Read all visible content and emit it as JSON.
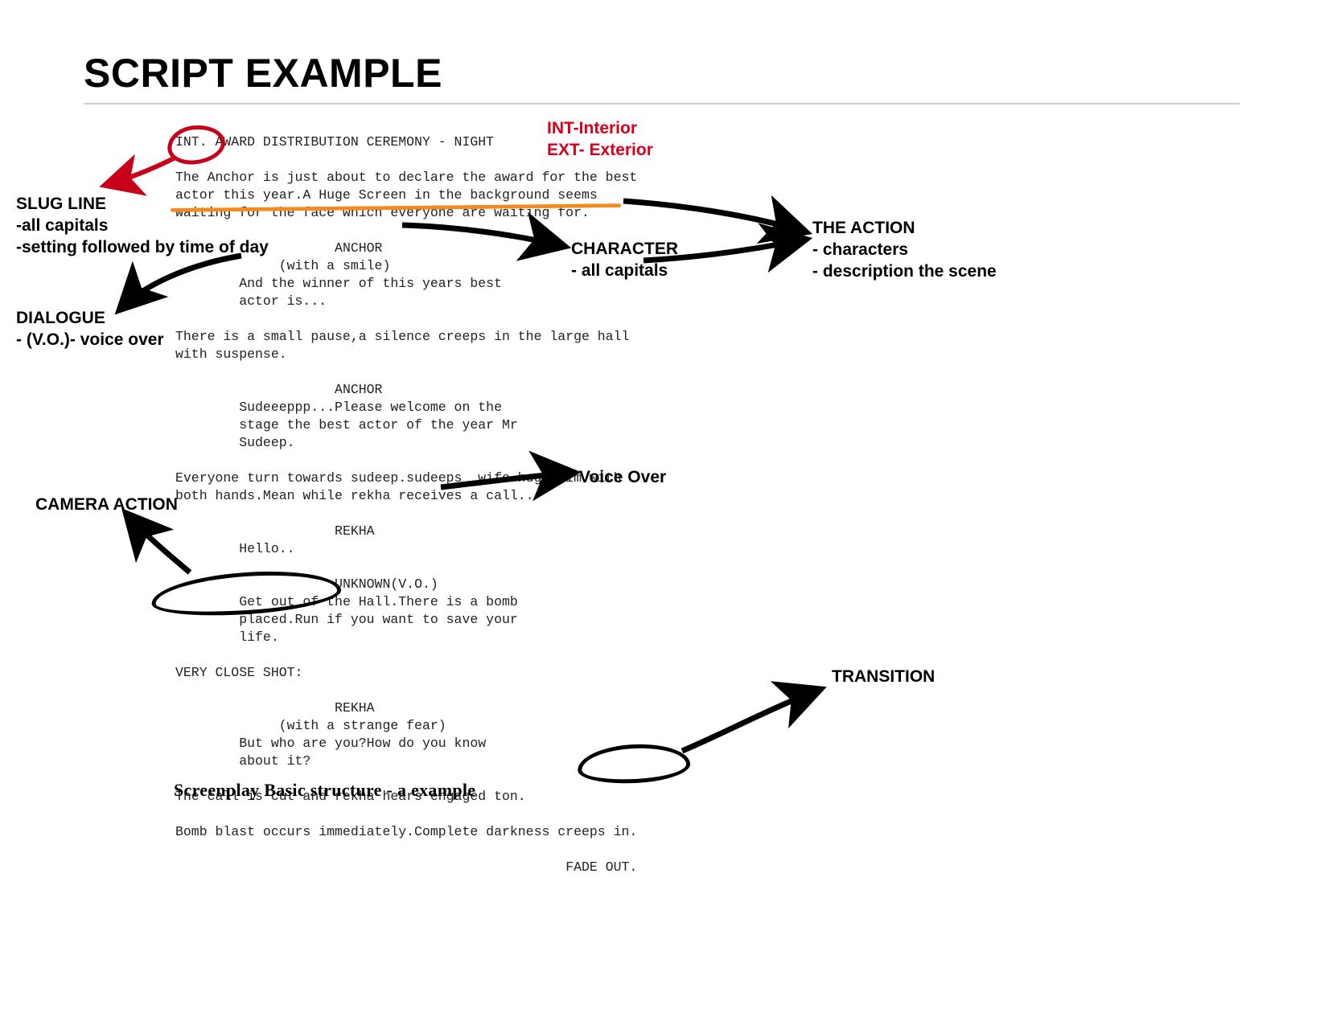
{
  "title": "SCRIPT EXAMPLE",
  "int_ext_note": "INT-Interior\nEXT- Exterior",
  "annotations": {
    "slug_line": "SLUG LINE\n-all capitals\n-setting followed by time of day",
    "dialogue": "DIALOGUE\n- (V.O.)- voice over",
    "camera": "CAMERA ACTION",
    "character": "CHARACTER\n- all capitals",
    "voice_over": "Voice Over",
    "action": "THE ACTION\n- characters\n- description the scene",
    "transition": "TRANSITION"
  },
  "screenplay_text": "INT. AWARD DISTRIBUTION CEREMONY - NIGHT\n\nThe Anchor is just about to declare the award for the best\nactor this year.A Huge Screen in the background seems\nwaiting for the face which everyone are waiting for.\n\n                    ANCHOR\n             (with a smile)\n        And the winner of this years best\n        actor is...\n\nThere is a small pause,a silence creeps in the large hall\nwith suspense.\n\n                    ANCHOR\n        Sudeeeppp...Please welcome on the\n        stage the best actor of the year Mr\n        Sudeep.\n\nEveryone turn towards sudeep.sudeeps  wife hugs him with\nboth hands.Mean while rekha receives a call..\n\n                    REKHA\n        Hello..\n\n                    UNKNOWN(V.O.)\n        Get out of the Hall.There is a bomb\n        placed.Run if you want to save your\n        life.\n\nVERY CLOSE SHOT:\n\n                    REKHA\n             (with a strange fear)\n        But who are you?How do you know\n        about it?\n\nThe call is cut and rekha hears engaged ton.\n\nBomb blast occurs immediately.Complete darkness creeps in.\n\n                                                 FADE OUT.",
  "caption": "Screenplay Basic structure - a example",
  "colors": {
    "red": "#d6001a",
    "orange": "#f58a1f"
  }
}
